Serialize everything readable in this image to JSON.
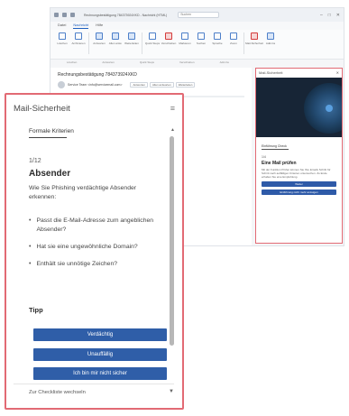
{
  "outlook": {
    "window_title": "Rechnungsbestätigung 784373924XKD - Nachricht (HTML)",
    "search_placeholder": "Suchen",
    "window_controls": [
      "–",
      "□",
      "✕"
    ],
    "menu": [
      "Datei",
      "Nachricht",
      "Hilfe"
    ],
    "ribbon_buttons": [
      "Löschen",
      "Archivieren",
      "Antworten",
      "Allen antw.",
      "Weiterleiten",
      "Quick Steps",
      "Verschieben",
      "Markieren",
      "Suchen",
      "Sprache",
      "Zoom",
      "Mail-Sicherheit",
      "Add-Ins"
    ],
    "ribbon_groups": [
      "Löschen",
      "Antworten",
      "Quick Steps",
      "Verschieben",
      "Add-Ins"
    ],
    "mail": {
      "subject": "Rechnungsbestätigung 784373924XKD",
      "from": "Service Team <info@servicemail.com>",
      "actions": [
        "Antworten",
        "Allen antworten",
        "Weiterleiten"
      ]
    },
    "addin_small": {
      "title": "Mail-Sicherheit",
      "tab": "Einführung Check",
      "step": "1/4",
      "heading": "Eine Mail prüfen",
      "text": "Mit der Funktion Prüfen können Sie Ihre Emails Schritt für Schritt nach auffälligen Kriterien untersuchen. Zu Ende erhalten Sie eine Empfehlung.",
      "buttons": [
        "Weiter",
        "Einführung nicht mehr anzeigen"
      ]
    }
  },
  "panel": {
    "title": "Mail-Sicherheit",
    "close": "≡",
    "section": "Formale Kriterien",
    "step": "1/12",
    "heading": "Absender",
    "intro": "Wie Sie Phishing verdächtige Absender erkennen:",
    "bullets": [
      "Passt die E-Mail-Adresse zum angeblichen Absender?",
      "Hat sie eine ungewöhnliche Domain?",
      "Enthält sie unnötige Zeichen?"
    ],
    "tips": "Tipp",
    "buttons": [
      "Verdächtig",
      "Unauffällig",
      "Ich bin mir nicht sicher"
    ],
    "footer": "Zur Checkliste wechseln",
    "caret_up": "▲",
    "caret_down": "▼"
  },
  "colors": {
    "accent_border": "#e26a74",
    "button_blue": "#2f5ea8",
    "hero_dark": "#172536"
  }
}
